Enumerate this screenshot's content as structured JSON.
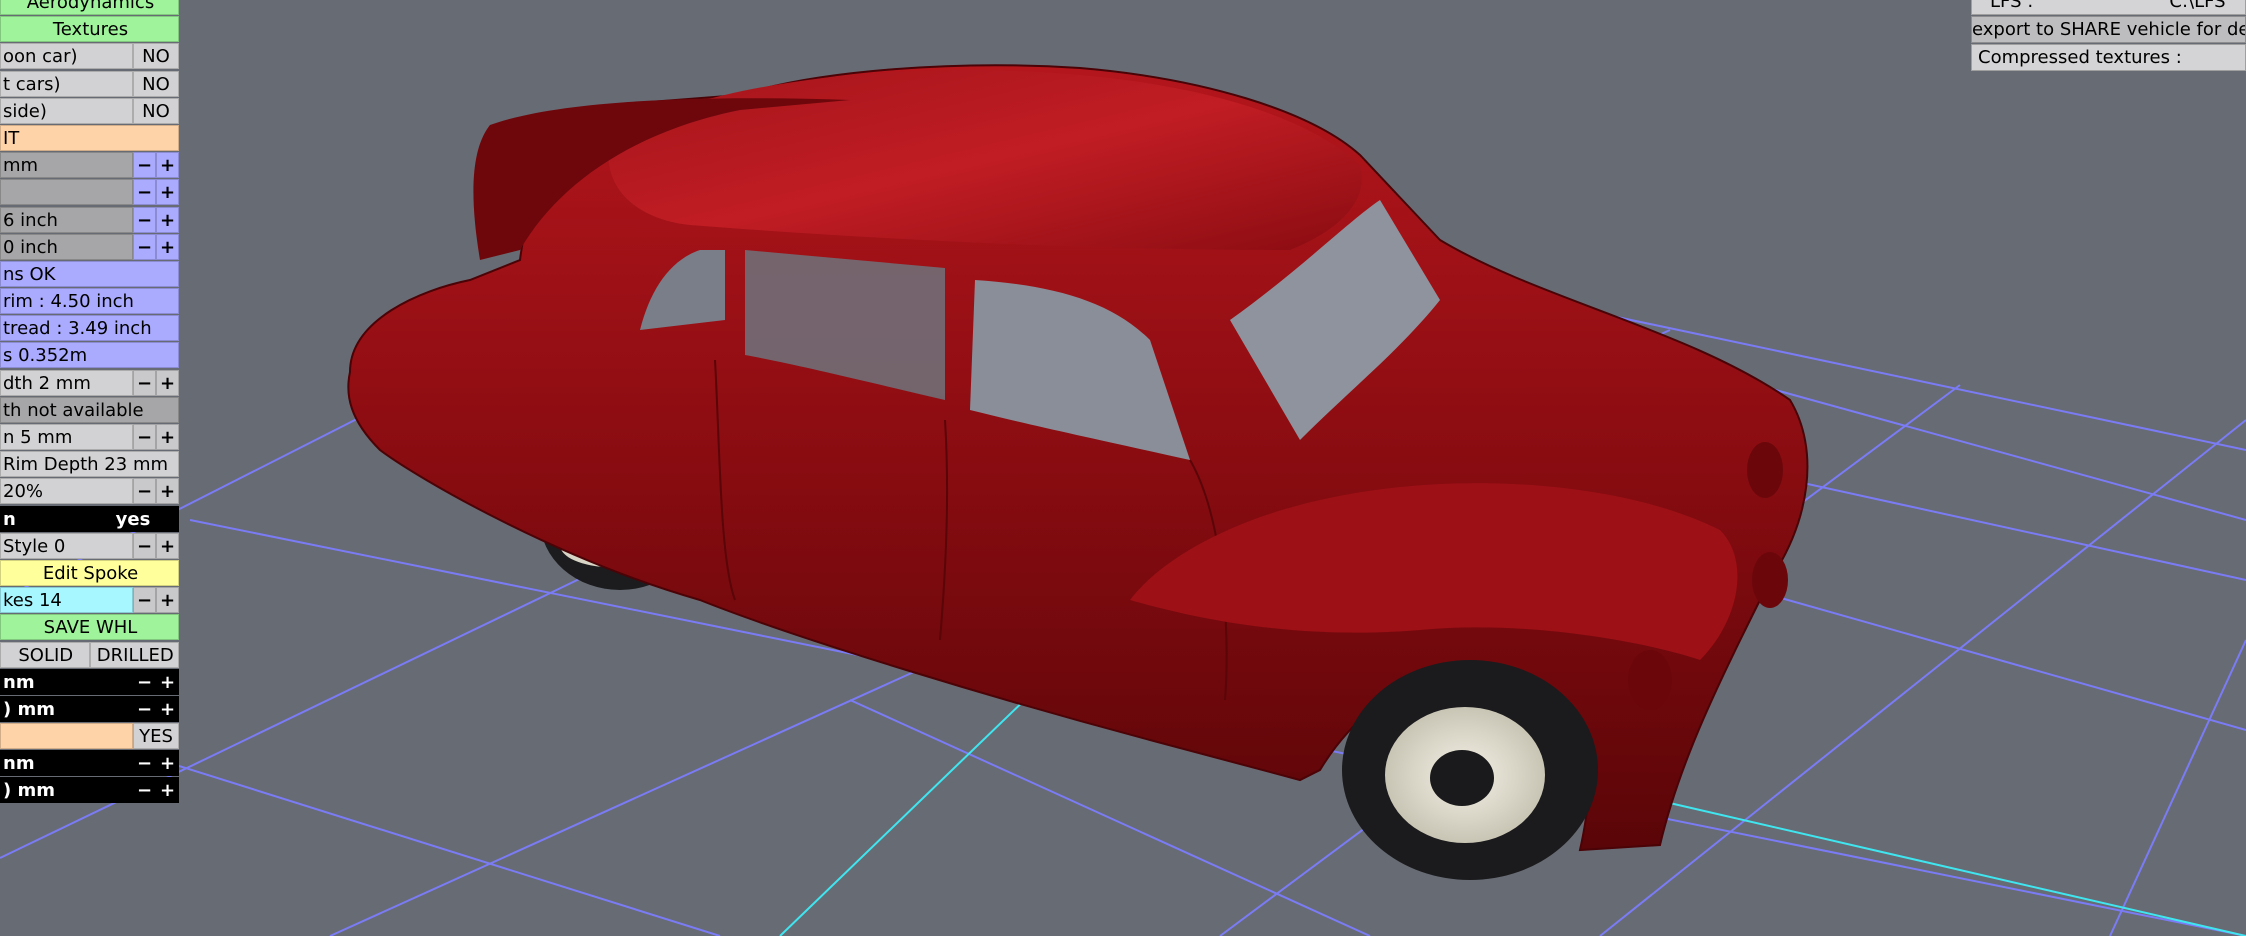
{
  "left_panel": {
    "rows": [
      {
        "type": "full",
        "label": "Aerodynamics",
        "color": "green"
      },
      {
        "type": "full",
        "label": "Textures",
        "color": "green"
      },
      {
        "type": "lv",
        "label": "oon car)",
        "value": "NO"
      },
      {
        "type": "lv",
        "label": "t cars)",
        "value": "NO"
      },
      {
        "type": "lv",
        "label": " side)",
        "value": "NO"
      },
      {
        "type": "head",
        "label": "IT",
        "color": "orange"
      },
      {
        "type": "pm",
        "label": "mm",
        "color": "dgrey",
        "pm": "blue"
      },
      {
        "type": "pm",
        "label": "",
        "color": "dgrey",
        "pm": "blue"
      },
      {
        "type": "pm",
        "label": "6 inch",
        "color": "dgrey",
        "pm": "blue"
      },
      {
        "type": "pm",
        "label": "0 inch",
        "color": "dgrey",
        "pm": "blue"
      },
      {
        "type": "info",
        "label": "ns OK",
        "color": "blue"
      },
      {
        "type": "info",
        "label": " rim : 4.50 inch",
        "color": "blue"
      },
      {
        "type": "info",
        "label": "    tread : 3.49 inch",
        "color": "blue"
      },
      {
        "type": "info",
        "label": "s 0.352m",
        "color": "blue"
      },
      {
        "type": "pm",
        "label": "dth 2 mm",
        "color": "grey",
        "pm": "grey"
      },
      {
        "type": "info",
        "label": "th not available",
        "color": "dgrey"
      },
      {
        "type": "pm",
        "label": "n 5 mm",
        "color": "grey",
        "pm": "grey"
      },
      {
        "type": "info",
        "label": "Rim Depth 23 mm",
        "color": "grey"
      },
      {
        "type": "pm",
        "label": "20%",
        "color": "grey",
        "pm": "grey"
      },
      {
        "type": "black2",
        "label": "n",
        "value": "yes"
      },
      {
        "type": "pm",
        "label": " Style 0",
        "color": "grey",
        "pm": "grey"
      },
      {
        "type": "full",
        "label": "Edit Spoke",
        "color": "yellow"
      },
      {
        "type": "pm",
        "label": "kes 14",
        "color": "cyan",
        "pm": "grey"
      },
      {
        "type": "full",
        "label": "SAVE WHL",
        "color": "green"
      },
      {
        "type": "two",
        "a": "SOLID",
        "b": "DRILLED"
      },
      {
        "type": "pm",
        "label": "nm",
        "color": "black",
        "pm": "black"
      },
      {
        "type": "pm",
        "label": ") mm",
        "color": "black",
        "pm": "black"
      },
      {
        "type": "lv",
        "label": "",
        "value": "YES",
        "color": "orange"
      },
      {
        "type": "pm",
        "label": "nm",
        "color": "black",
        "pm": "black"
      },
      {
        "type": "pm",
        "label": ") mm",
        "color": "black",
        "pm": "black"
      }
    ],
    "minus": "−",
    "plus": "+"
  },
  "right_panel": {
    "lfs_label": "LFS :",
    "lfs_path": "C:\\LFS",
    "export_label": " export to SHARE vehicle for de",
    "compressed_label": "Compressed textures :"
  },
  "viewport": {
    "background": "#676b74",
    "grid_color": "#7b7cf5",
    "axis_color": "#3fe6f0",
    "car_color": "#8b0d12"
  }
}
